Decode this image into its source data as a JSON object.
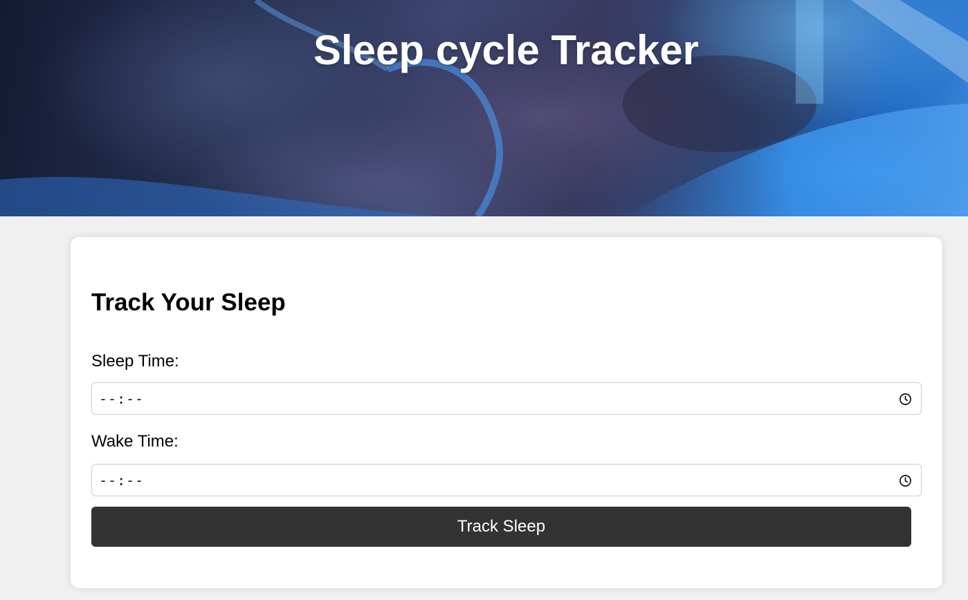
{
  "header": {
    "title": "Sleep cycle Tracker",
    "background_image": "sleeping-person-photo"
  },
  "form": {
    "heading": "Track Your Sleep",
    "sleep_time": {
      "label": "Sleep Time:",
      "value": "--:--",
      "icon": "clock-icon"
    },
    "wake_time": {
      "label": "Wake Time:",
      "value": "--:--",
      "icon": "clock-icon"
    },
    "submit_label": "Track Sleep"
  },
  "colors": {
    "page_background": "#f0f0f0",
    "card_background": "#ffffff",
    "button_background": "#333333",
    "button_text": "#ffffff",
    "input_border": "#cccccc"
  }
}
